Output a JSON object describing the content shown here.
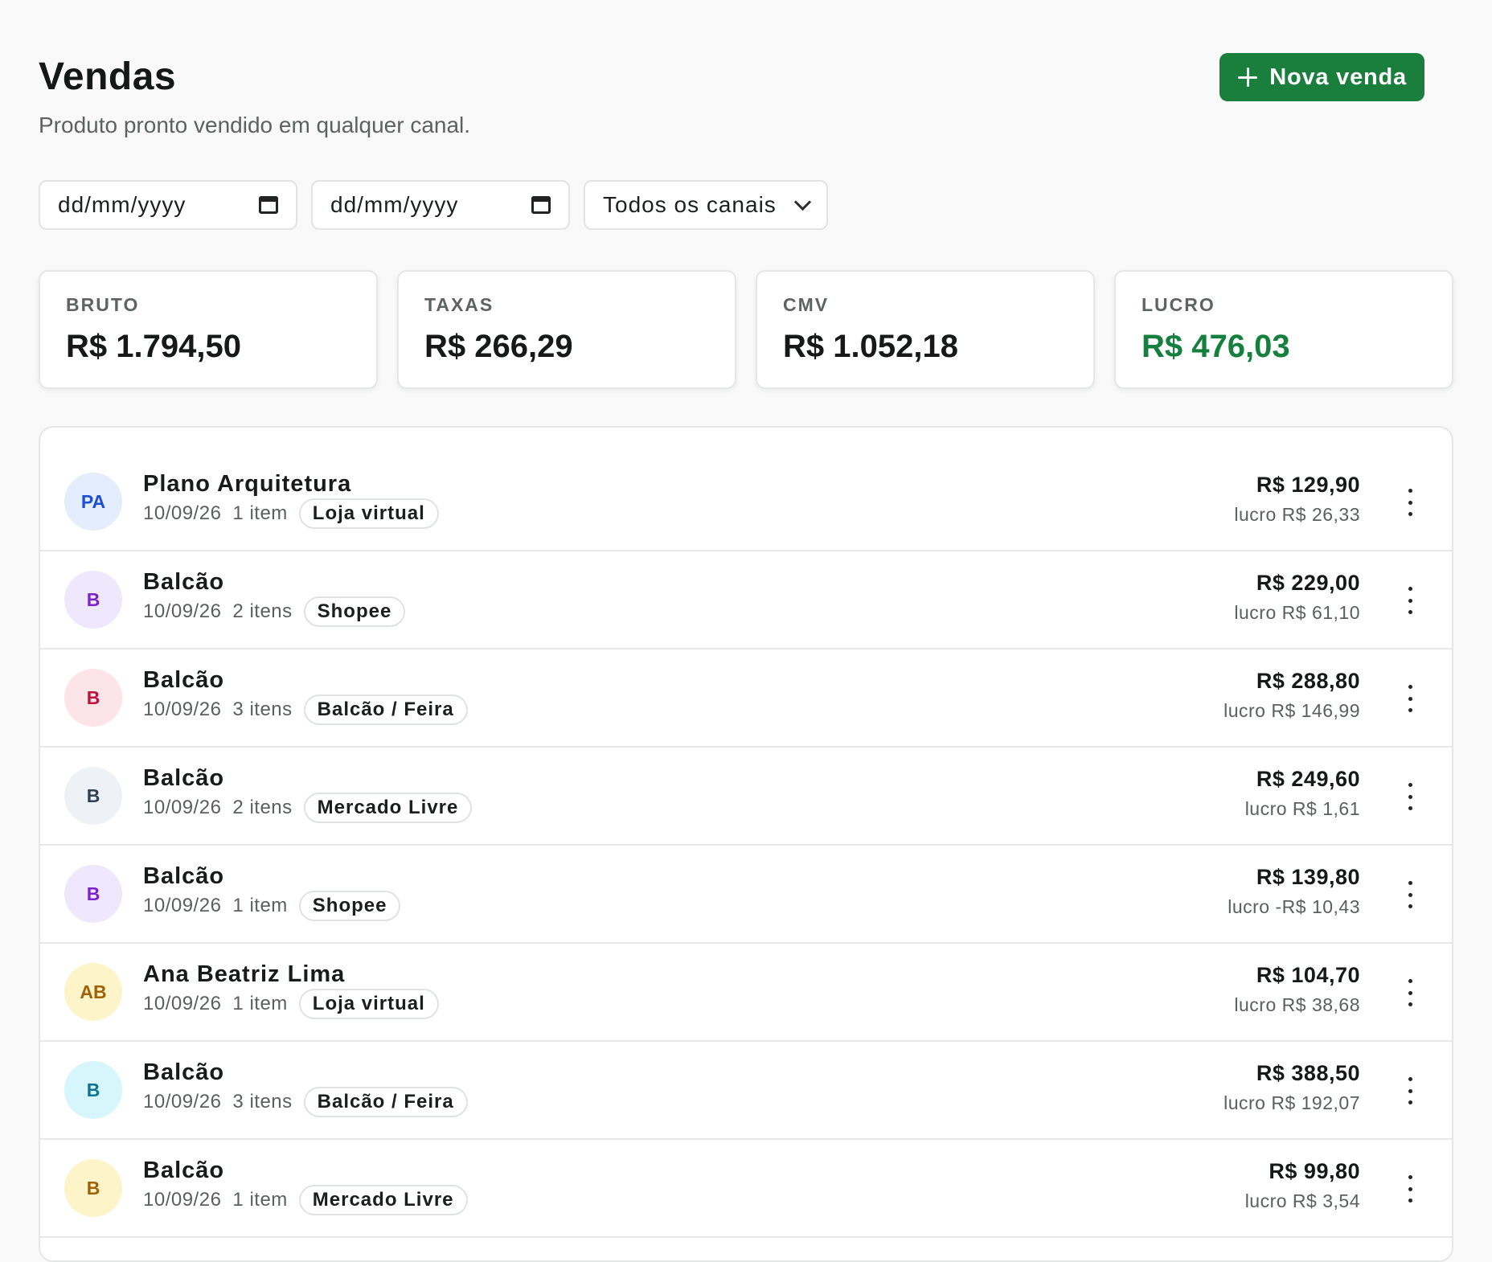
{
  "header": {
    "title": "Vendas",
    "subtitle": "Produto pronto vendido em qualquer canal.",
    "new_sale_label": "Nova venda"
  },
  "filters": {
    "start_date_placeholder": "dd/mm/yyyy",
    "end_date_placeholder": "dd/mm/yyyy",
    "channel_selected": "Todos os canais"
  },
  "summary": {
    "gross": {
      "label": "BRUTO",
      "value": "R$ 1.794,50"
    },
    "fees": {
      "label": "TAXAS",
      "value": "R$ 266,29"
    },
    "cogs": {
      "label": "CMV",
      "value": "R$ 1.052,18"
    },
    "profit": {
      "label": "LUCRO",
      "value": "R$ 476,03"
    }
  },
  "colors": {
    "accent": "#1a7f3c",
    "profit": "#15803d"
  },
  "sales": [
    {
      "initials": "PA",
      "name": "Plano Arquitetura",
      "date": "10/09/26",
      "items": "1 item",
      "channel": "Loja virtual",
      "total": "R$ 129,90",
      "profit": "lucro R$ 26,33",
      "avatar_bg": "#e4edfb",
      "avatar_fg": "#1d4ed8"
    },
    {
      "initials": "B",
      "name": "Balcão",
      "date": "10/09/26",
      "items": "2 itens",
      "channel": "Shopee",
      "total": "R$ 229,00",
      "profit": "lucro R$ 61,10",
      "avatar_bg": "#efe8fd",
      "avatar_fg": "#7e22ce"
    },
    {
      "initials": "B",
      "name": "Balcão",
      "date": "10/09/26",
      "items": "3 itens",
      "channel": "Balcão / Feira",
      "total": "R$ 288,80",
      "profit": "lucro R$ 146,99",
      "avatar_bg": "#fde4e8",
      "avatar_fg": "#be123c"
    },
    {
      "initials": "B",
      "name": "Balcão",
      "date": "10/09/26",
      "items": "2 itens",
      "channel": "Mercado Livre",
      "total": "R$ 249,60",
      "profit": "lucro R$ 1,61",
      "avatar_bg": "#eef2f6",
      "avatar_fg": "#334155"
    },
    {
      "initials": "B",
      "name": "Balcão",
      "date": "10/09/26",
      "items": "1 item",
      "channel": "Shopee",
      "total": "R$ 139,80",
      "profit": "lucro -R$ 10,43",
      "avatar_bg": "#efe8fd",
      "avatar_fg": "#7e22ce"
    },
    {
      "initials": "AB",
      "name": "Ana Beatriz Lima",
      "date": "10/09/26",
      "items": "1 item",
      "channel": "Loja virtual",
      "total": "R$ 104,70",
      "profit": "lucro R$ 38,68",
      "avatar_bg": "#fdf5c9",
      "avatar_fg": "#a16207"
    },
    {
      "initials": "B",
      "name": "Balcão",
      "date": "10/09/26",
      "items": "3 itens",
      "channel": "Balcão / Feira",
      "total": "R$ 388,50",
      "profit": "lucro R$ 192,07",
      "avatar_bg": "#d7f6fb",
      "avatar_fg": "#0e7490"
    },
    {
      "initials": "B",
      "name": "Balcão",
      "date": "10/09/26",
      "items": "1 item",
      "channel": "Mercado Livre",
      "total": "R$ 99,80",
      "profit": "lucro R$ 3,54",
      "avatar_bg": "#fdf5c9",
      "avatar_fg": "#a16207"
    }
  ]
}
